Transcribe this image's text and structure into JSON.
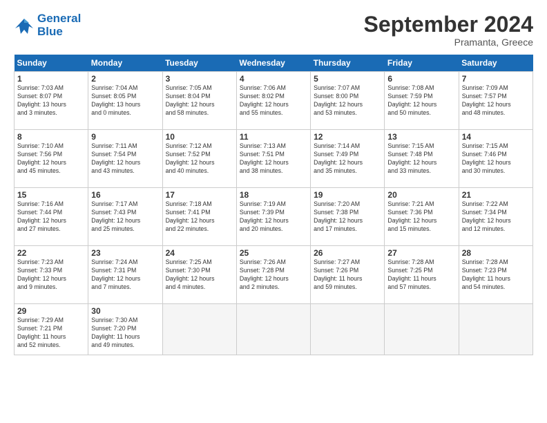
{
  "header": {
    "logo_line1": "General",
    "logo_line2": "Blue",
    "month": "September 2024",
    "location": "Pramanta, Greece"
  },
  "days_of_week": [
    "Sunday",
    "Monday",
    "Tuesday",
    "Wednesday",
    "Thursday",
    "Friday",
    "Saturday"
  ],
  "weeks": [
    [
      {
        "day": "1",
        "info": "Sunrise: 7:03 AM\nSunset: 8:07 PM\nDaylight: 13 hours\nand 3 minutes."
      },
      {
        "day": "2",
        "info": "Sunrise: 7:04 AM\nSunset: 8:05 PM\nDaylight: 13 hours\nand 0 minutes."
      },
      {
        "day": "3",
        "info": "Sunrise: 7:05 AM\nSunset: 8:04 PM\nDaylight: 12 hours\nand 58 minutes."
      },
      {
        "day": "4",
        "info": "Sunrise: 7:06 AM\nSunset: 8:02 PM\nDaylight: 12 hours\nand 55 minutes."
      },
      {
        "day": "5",
        "info": "Sunrise: 7:07 AM\nSunset: 8:00 PM\nDaylight: 12 hours\nand 53 minutes."
      },
      {
        "day": "6",
        "info": "Sunrise: 7:08 AM\nSunset: 7:59 PM\nDaylight: 12 hours\nand 50 minutes."
      },
      {
        "day": "7",
        "info": "Sunrise: 7:09 AM\nSunset: 7:57 PM\nDaylight: 12 hours\nand 48 minutes."
      }
    ],
    [
      {
        "day": "8",
        "info": "Sunrise: 7:10 AM\nSunset: 7:56 PM\nDaylight: 12 hours\nand 45 minutes."
      },
      {
        "day": "9",
        "info": "Sunrise: 7:11 AM\nSunset: 7:54 PM\nDaylight: 12 hours\nand 43 minutes."
      },
      {
        "day": "10",
        "info": "Sunrise: 7:12 AM\nSunset: 7:52 PM\nDaylight: 12 hours\nand 40 minutes."
      },
      {
        "day": "11",
        "info": "Sunrise: 7:13 AM\nSunset: 7:51 PM\nDaylight: 12 hours\nand 38 minutes."
      },
      {
        "day": "12",
        "info": "Sunrise: 7:14 AM\nSunset: 7:49 PM\nDaylight: 12 hours\nand 35 minutes."
      },
      {
        "day": "13",
        "info": "Sunrise: 7:15 AM\nSunset: 7:48 PM\nDaylight: 12 hours\nand 33 minutes."
      },
      {
        "day": "14",
        "info": "Sunrise: 7:15 AM\nSunset: 7:46 PM\nDaylight: 12 hours\nand 30 minutes."
      }
    ],
    [
      {
        "day": "15",
        "info": "Sunrise: 7:16 AM\nSunset: 7:44 PM\nDaylight: 12 hours\nand 27 minutes."
      },
      {
        "day": "16",
        "info": "Sunrise: 7:17 AM\nSunset: 7:43 PM\nDaylight: 12 hours\nand 25 minutes."
      },
      {
        "day": "17",
        "info": "Sunrise: 7:18 AM\nSunset: 7:41 PM\nDaylight: 12 hours\nand 22 minutes."
      },
      {
        "day": "18",
        "info": "Sunrise: 7:19 AM\nSunset: 7:39 PM\nDaylight: 12 hours\nand 20 minutes."
      },
      {
        "day": "19",
        "info": "Sunrise: 7:20 AM\nSunset: 7:38 PM\nDaylight: 12 hours\nand 17 minutes."
      },
      {
        "day": "20",
        "info": "Sunrise: 7:21 AM\nSunset: 7:36 PM\nDaylight: 12 hours\nand 15 minutes."
      },
      {
        "day": "21",
        "info": "Sunrise: 7:22 AM\nSunset: 7:34 PM\nDaylight: 12 hours\nand 12 minutes."
      }
    ],
    [
      {
        "day": "22",
        "info": "Sunrise: 7:23 AM\nSunset: 7:33 PM\nDaylight: 12 hours\nand 9 minutes."
      },
      {
        "day": "23",
        "info": "Sunrise: 7:24 AM\nSunset: 7:31 PM\nDaylight: 12 hours\nand 7 minutes."
      },
      {
        "day": "24",
        "info": "Sunrise: 7:25 AM\nSunset: 7:30 PM\nDaylight: 12 hours\nand 4 minutes."
      },
      {
        "day": "25",
        "info": "Sunrise: 7:26 AM\nSunset: 7:28 PM\nDaylight: 12 hours\nand 2 minutes."
      },
      {
        "day": "26",
        "info": "Sunrise: 7:27 AM\nSunset: 7:26 PM\nDaylight: 11 hours\nand 59 minutes."
      },
      {
        "day": "27",
        "info": "Sunrise: 7:28 AM\nSunset: 7:25 PM\nDaylight: 11 hours\nand 57 minutes."
      },
      {
        "day": "28",
        "info": "Sunrise: 7:28 AM\nSunset: 7:23 PM\nDaylight: 11 hours\nand 54 minutes."
      }
    ],
    [
      {
        "day": "29",
        "info": "Sunrise: 7:29 AM\nSunset: 7:21 PM\nDaylight: 11 hours\nand 52 minutes."
      },
      {
        "day": "30",
        "info": "Sunrise: 7:30 AM\nSunset: 7:20 PM\nDaylight: 11 hours\nand 49 minutes."
      },
      {
        "day": "",
        "info": ""
      },
      {
        "day": "",
        "info": ""
      },
      {
        "day": "",
        "info": ""
      },
      {
        "day": "",
        "info": ""
      },
      {
        "day": "",
        "info": ""
      }
    ]
  ]
}
